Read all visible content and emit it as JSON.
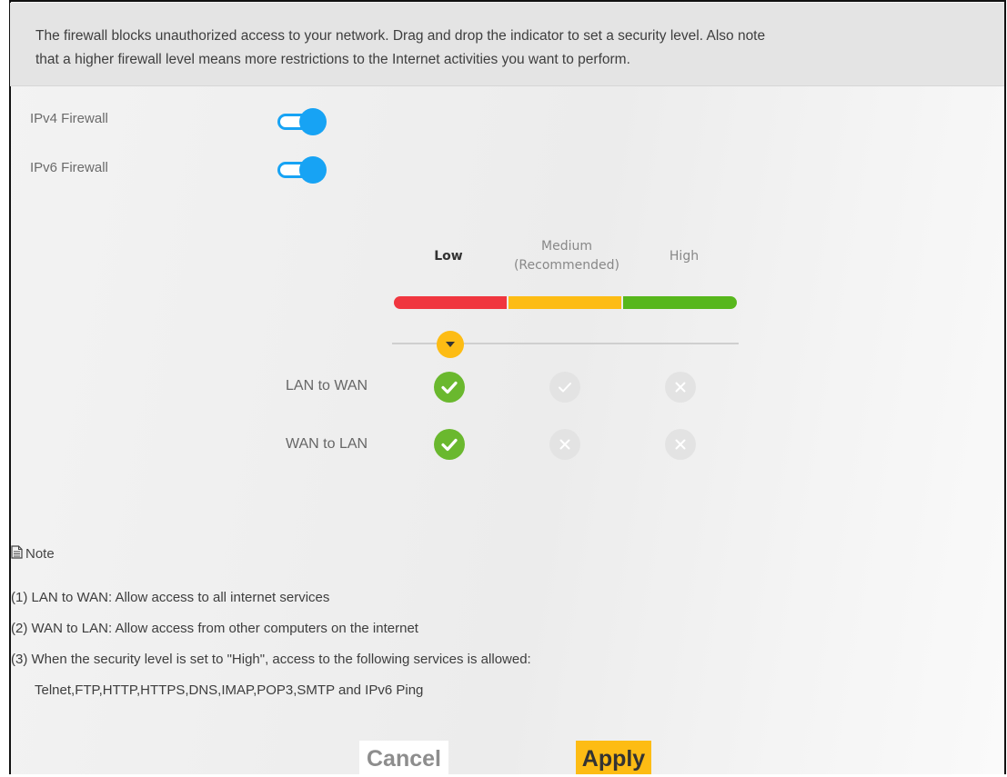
{
  "description": {
    "line1": "The firewall blocks unauthorized access to your network. Drag and drop the indicator to set a security level. Also note",
    "line2": "that a higher firewall level means more restrictions to the Internet activities you want to perform."
  },
  "firewalls": [
    {
      "label": "IPv4 Firewall",
      "enabled": true
    },
    {
      "label": "IPv6 Firewall",
      "enabled": true
    }
  ],
  "levels": {
    "low": "Low",
    "medium_line1": "Medium",
    "medium_line2": "(Recommended)",
    "high": "High",
    "colors": {
      "low": "#f0363f",
      "medium": "#fdbc14",
      "high": "#57b71c"
    },
    "selected": "Low"
  },
  "rules": [
    {
      "label": "LAN to WAN",
      "low": "allowed",
      "medium": "allowed",
      "high": "blocked"
    },
    {
      "label": "WAN to LAN",
      "low": "allowed",
      "medium": "blocked",
      "high": "blocked"
    }
  ],
  "note": {
    "title": "Note",
    "items": [
      "(1) LAN to WAN: Allow access to all internet services",
      "(2) WAN to LAN: Allow access from other computers on the internet",
      "(3) When the security level is set to \"High\", access to the following services is allowed:",
      "Telnet,FTP,HTTP,HTTPS,DNS,IMAP,POP3,SMTP and IPv6 Ping"
    ]
  },
  "buttons": {
    "cancel": "Cancel",
    "apply": "Apply"
  },
  "accent": "#17a3f4"
}
